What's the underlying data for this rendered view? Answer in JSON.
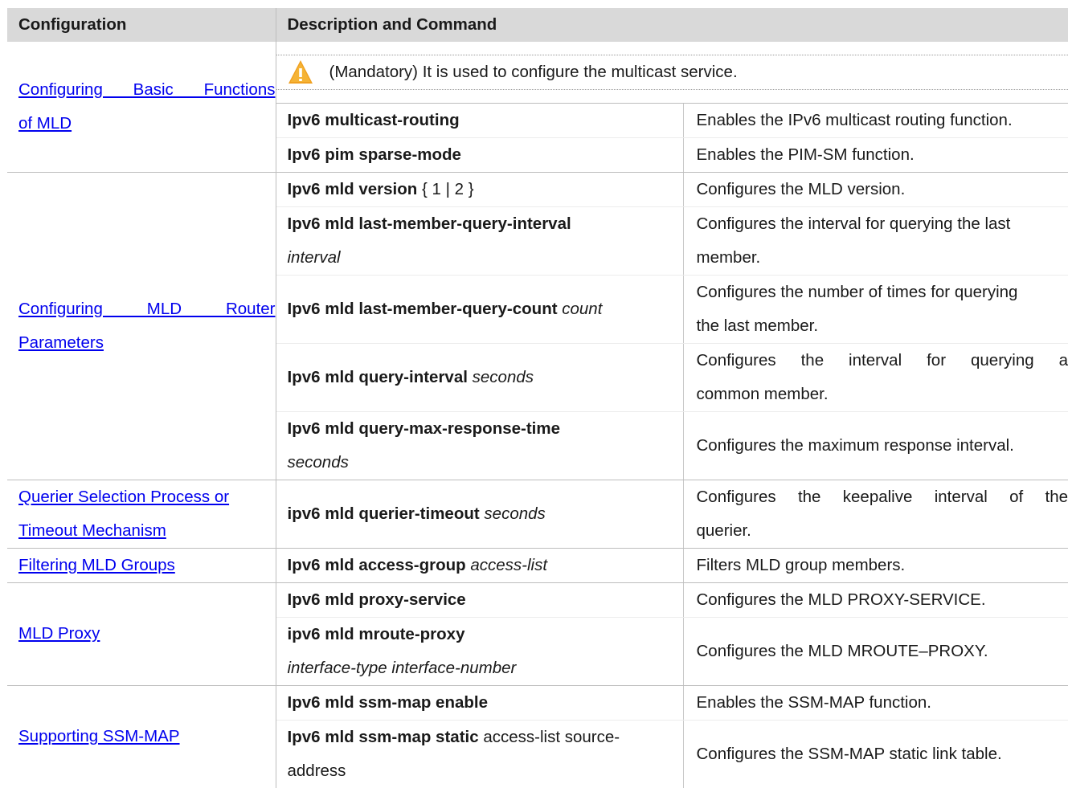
{
  "header": {
    "col1": "Configuration",
    "col2": "Description and Command"
  },
  "groups": [
    {
      "link_lines": [
        "Configuring Basic Functions",
        "of MLD"
      ],
      "note": "(Mandatory) It is used to configure the multicast service.",
      "rows": [
        {
          "cmd_bold": "Ipv6 multicast-routing",
          "desc": "Enables the IPv6 multicast routing function."
        },
        {
          "cmd_bold": "Ipv6 pim sparse-mode",
          "desc": "Enables the PIM-SM function."
        }
      ]
    },
    {
      "link_lines": [
        "Configuring MLD Router",
        "Parameters"
      ],
      "rows": [
        {
          "cmd_bold": "Ipv6 mld version",
          "cmd_rest": "{ 1 | 2 }",
          "desc": "Configures the MLD version."
        },
        {
          "cmd_bold": "Ipv6 mld last-member-query-interval",
          "cmd_italic": "interval",
          "desc_lines": [
            "Configures the interval for querying the last",
            "member."
          ]
        },
        {
          "cmd_bold": "Ipv6 mld last-member-query-count",
          "cmd_italic": "count",
          "desc_lines": [
            "Configures the number of times for querying",
            "the last member."
          ]
        },
        {
          "cmd_bold": "Ipv6 mld query-interval",
          "cmd_italic": "seconds",
          "desc_lines": [
            "Configures the interval for querying a",
            "common member."
          ]
        },
        {
          "cmd_bold": "Ipv6 mld query-max-response-time",
          "cmd_italic": "seconds",
          "desc": "Configures the maximum response interval."
        }
      ]
    },
    {
      "link_lines": [
        "Querier Selection Process or",
        "Timeout Mechanism"
      ],
      "rows": [
        {
          "cmd_bold": "ipv6 mld querier-timeout",
          "cmd_italic": "seconds",
          "desc_lines": [
            "Configures the keepalive interval of the",
            "querier."
          ]
        }
      ]
    },
    {
      "link_lines": [
        "Filtering MLD Groups"
      ],
      "rows": [
        {
          "cmd_bold": "Ipv6 mld access-group",
          "cmd_italic": "access-list",
          "desc": "Filters MLD group members."
        }
      ]
    },
    {
      "link_lines": [
        "MLD Proxy"
      ],
      "rows": [
        {
          "cmd_bold": "Ipv6 mld proxy-service",
          "desc": "Configures the MLD PROXY-SERVICE."
        },
        {
          "cmd_bold": "ipv6 mld mroute-proxy",
          "cmd_italic": "interface-type interface-number",
          "desc": "Configures the MLD MROUTE–PROXY."
        }
      ]
    },
    {
      "link_lines": [
        "Supporting SSM-MAP"
      ],
      "rows": [
        {
          "cmd_bold": "Ipv6 mld ssm-map enable",
          "desc": "Enables the SSM-MAP function."
        },
        {
          "cmd_bold": "Ipv6 mld ssm-map static",
          "cmd_rest": "access-list source-",
          "cmd_rest2": "address",
          "desc": "Configures the SSM-MAP static link table."
        }
      ]
    }
  ],
  "icons": {
    "note_icon": "warning-triangle-icon",
    "warn_color": "#f0a020"
  }
}
